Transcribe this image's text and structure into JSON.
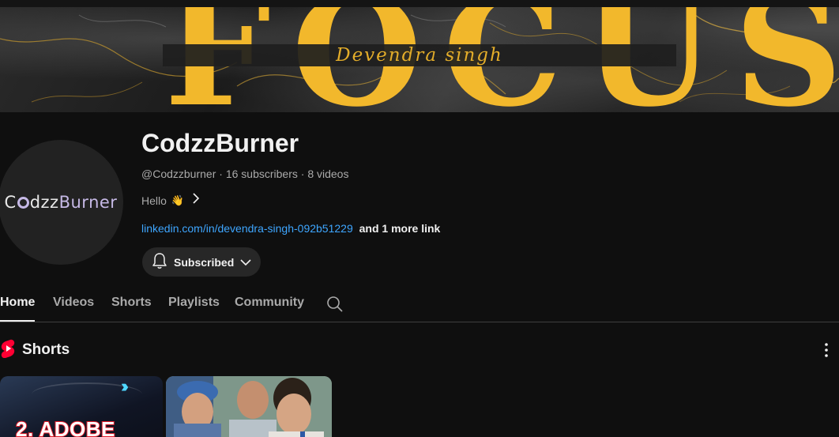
{
  "banner": {
    "headline": "FOCUS",
    "signature": "Devendra singh"
  },
  "channel": {
    "avatar_text_prefix": "C",
    "avatar_text_mid": "dzz",
    "avatar_text_suffix": "Burner",
    "title": "CodzzBurner",
    "handle": "@Codzzburner",
    "subscribers": "16 subscribers",
    "videos": "8 videos",
    "separator": "·",
    "description": "Hello",
    "description_emoji": "👋",
    "link": "linkedin.com/in/devendra-singh-092b51229",
    "more_links": "and 1 more link",
    "subscribe_label": "Subscribed"
  },
  "tabs": [
    {
      "label": "Home",
      "active": true
    },
    {
      "label": "Videos",
      "active": false
    },
    {
      "label": "Shorts",
      "active": false
    },
    {
      "label": "Playlists",
      "active": false
    },
    {
      "label": "Community",
      "active": false
    }
  ],
  "shorts": {
    "title": "Shorts",
    "items": [
      {
        "thumb_text": "2. ADOBE"
      },
      {
        "thumb_text": ""
      }
    ]
  },
  "colors": {
    "background": "#0f0f0f",
    "banner_accent": "#f2b82c",
    "link": "#3ea6ff",
    "shorts_red": "#ff0033"
  },
  "icons": {
    "bell": "bell-icon",
    "chevron_down": "chevron-down-icon",
    "chevron_right": "chevron-right-icon",
    "search": "search-icon",
    "shorts_logo": "shorts-logo-icon",
    "more": "more-vert-icon"
  }
}
